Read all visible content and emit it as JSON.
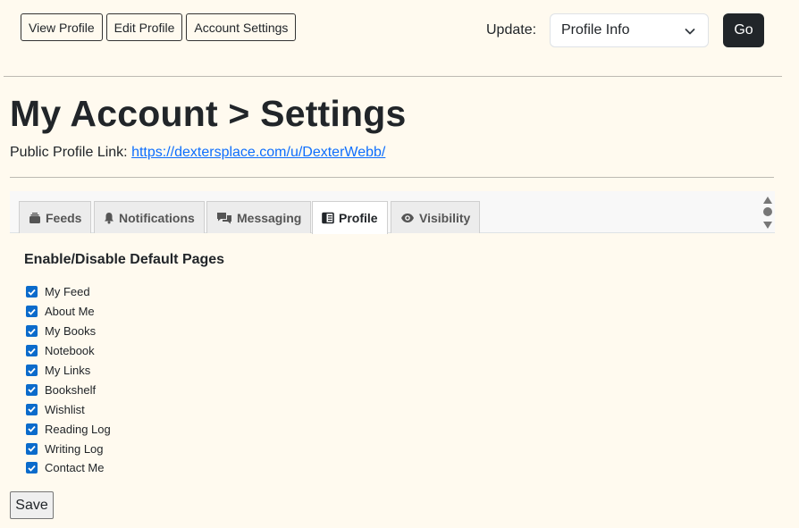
{
  "topnav": {
    "view_profile": "View Profile",
    "edit_profile": "Edit Profile",
    "account_settings": "Account Settings"
  },
  "update": {
    "label": "Update:",
    "selected": "Profile Info",
    "go_label": "Go"
  },
  "page": {
    "title": "My Account > Settings",
    "profile_link_label": "Public Profile Link:",
    "profile_link_url": "https://dextersplace.com/u/DexterWebb/"
  },
  "tabs": [
    {
      "label": "Feeds",
      "icon": "feeds-icon",
      "active": false
    },
    {
      "label": "Notifications",
      "icon": "bell-icon",
      "active": false
    },
    {
      "label": "Messaging",
      "icon": "chat-icon",
      "active": false
    },
    {
      "label": "Profile",
      "icon": "profile-icon",
      "active": true
    },
    {
      "label": "Visibility",
      "icon": "eye-icon",
      "active": false
    }
  ],
  "section": {
    "heading": "Enable/Disable Default Pages",
    "pages": [
      {
        "label": "My Feed",
        "checked": true
      },
      {
        "label": "About Me",
        "checked": true
      },
      {
        "label": "My Books",
        "checked": true
      },
      {
        "label": "Notebook",
        "checked": true
      },
      {
        "label": "My Links",
        "checked": true
      },
      {
        "label": "Bookshelf",
        "checked": true
      },
      {
        "label": "Wishlist",
        "checked": true
      },
      {
        "label": "Reading Log",
        "checked": true
      },
      {
        "label": "Writing Log",
        "checked": true
      },
      {
        "label": "Contact Me",
        "checked": true
      }
    ]
  },
  "save_label": "Save",
  "colors": {
    "background": "#fffaef",
    "accent": "#0d6efd",
    "checkbox": "#0b6bcb",
    "go_button": "#212529"
  }
}
